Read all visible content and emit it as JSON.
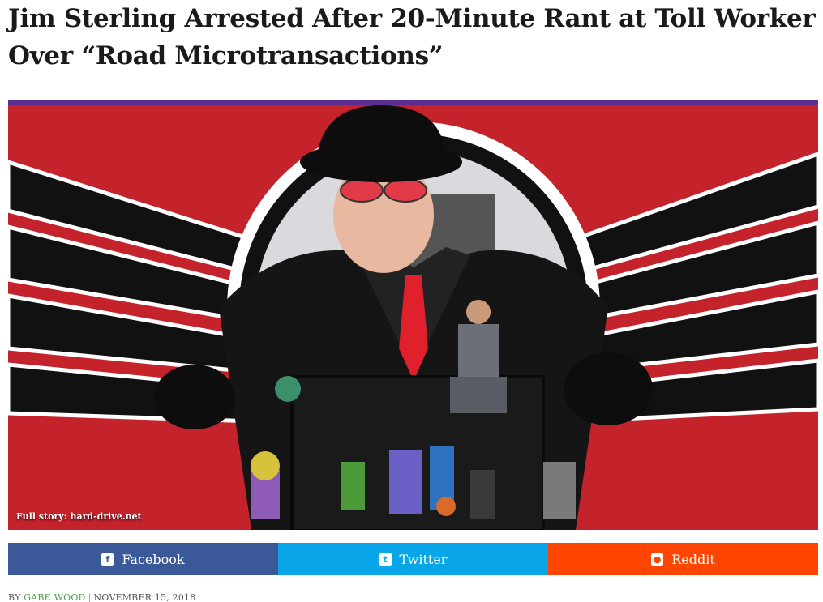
{
  "article": {
    "headline_line1": "Jim Sterling Arrested After 20-Minute Rant at Toll Worker",
    "headline_line2": "Over “Road Microtransactions”"
  },
  "image": {
    "caption": "Full story: hard-drive.net"
  },
  "share": {
    "facebook": {
      "label": "Facebook",
      "icon": "facebook-icon",
      "color": "#3b5998"
    },
    "twitter": {
      "label": "Twitter",
      "icon": "twitter-icon",
      "color": "#08a6e8"
    },
    "reddit": {
      "label": "Reddit",
      "icon": "reddit-icon",
      "color": "#ff4500"
    }
  },
  "byline": {
    "prefix": "BY",
    "author": "GABE WOOD",
    "separator": "|",
    "date": "NOVEMBER 15, 2018"
  },
  "colors": {
    "image_border": "#5b2d90",
    "author_link": "#4aa34a"
  }
}
